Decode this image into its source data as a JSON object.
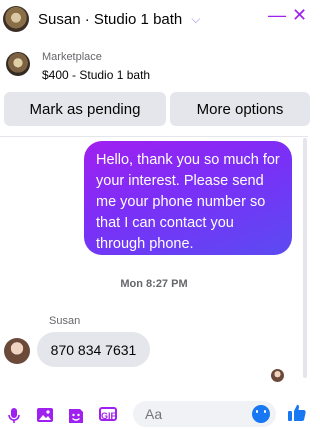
{
  "header": {
    "title": "Susan · Studio 1 bath",
    "chevron": "⌵",
    "minimize": "—",
    "close": "✕"
  },
  "product": {
    "category": "Marketplace",
    "description": "$400 - Studio 1 bath"
  },
  "actions": {
    "pending_label": "Mark as pending",
    "more_label": "More options"
  },
  "messages": {
    "outgoing": "Hello, thank you so much for your interest. Please send me your phone number so that I can contact you through phone.",
    "timestamp": "Mon 8:27 PM",
    "sender_name": "Susan",
    "incoming": "870 834 7631"
  },
  "composer": {
    "placeholder": "Aa",
    "gif_label": "GIF",
    "icons": [
      "microphone-icon",
      "image-icon",
      "sticker-icon",
      "gif-icon",
      "emoji-icon",
      "like-icon"
    ]
  },
  "colors": {
    "accent": "#a020f0",
    "bubble_out_start": "#a020f0",
    "bubble_out_end": "#5b4bf2",
    "bubble_in": "#e4e6eb",
    "like": "#1877f2"
  }
}
